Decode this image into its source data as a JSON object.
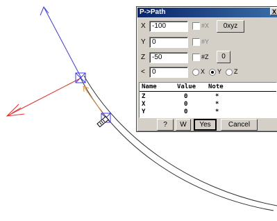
{
  "dialog": {
    "title": "P->Path",
    "close": "X",
    "fields": {
      "x_label": "X",
      "x_value": "-100",
      "y_label": "Y",
      "y_value": "0",
      "z_label": "Z",
      "z_value": "-50",
      "angle_label": "<",
      "angle_value": "0"
    },
    "checks": {
      "hx": "#X",
      "hy": "#Y",
      "hz": "#Z"
    },
    "buttons": {
      "oxyz": "0xyz",
      "zero": "0",
      "help": "?",
      "w": "W",
      "yes": "Yes",
      "cancel": "Cancel"
    },
    "radios": {
      "x": "X",
      "y": "Y",
      "z": "Z",
      "selected": "Y"
    },
    "table": {
      "headers": [
        "Name",
        "Value",
        "Note"
      ],
      "rows": [
        [
          "Z",
          "0",
          "*"
        ],
        [
          "X",
          "0",
          "*"
        ],
        [
          "Y",
          "0",
          "*"
        ]
      ]
    }
  },
  "colors": {
    "axis_y": "#3b3bf0",
    "axis_x": "#ee2b2b",
    "axis_z": "#f0963c"
  }
}
